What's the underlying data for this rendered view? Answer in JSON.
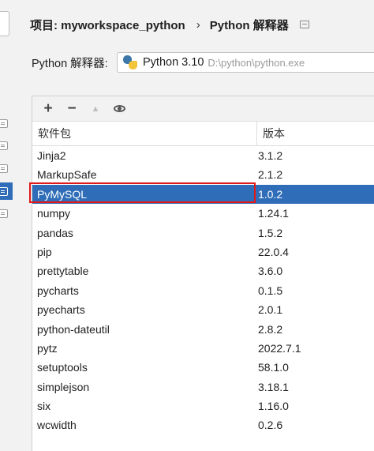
{
  "breadcrumb": {
    "project": "项目: myworkspace_python",
    "separator": "›",
    "page": "Python 解释器"
  },
  "interpreter": {
    "label": "Python 解释器:",
    "name": "Python 3.10",
    "path": "D:\\python\\python.exe"
  },
  "toolbar": {
    "add": "+",
    "remove": "−",
    "upgrade": "▲"
  },
  "table": {
    "columns": [
      "软件包",
      "版本"
    ],
    "rows": [
      {
        "name": "Jinja2",
        "version": "3.1.2"
      },
      {
        "name": "MarkupSafe",
        "version": "2.1.2"
      },
      {
        "name": "PyMySQL",
        "version": "1.0.2",
        "selected": true
      },
      {
        "name": "numpy",
        "version": "1.24.1"
      },
      {
        "name": "pandas",
        "version": "1.5.2"
      },
      {
        "name": "pip",
        "version": "22.0.4"
      },
      {
        "name": "prettytable",
        "version": "3.6.0"
      },
      {
        "name": "pycharts",
        "version": "0.1.5"
      },
      {
        "name": "pyecharts",
        "version": "2.0.1"
      },
      {
        "name": "python-dateutil",
        "version": "2.8.2"
      },
      {
        "name": "pytz",
        "version": "2022.7.1"
      },
      {
        "name": "setuptools",
        "version": "58.1.0"
      },
      {
        "name": "simplejson",
        "version": "3.18.1"
      },
      {
        "name": "six",
        "version": "1.16.0"
      },
      {
        "name": "wcwidth",
        "version": "0.2.6"
      }
    ]
  },
  "colors": {
    "selection": "#2f6db8",
    "highlight_box": "#e01818"
  }
}
